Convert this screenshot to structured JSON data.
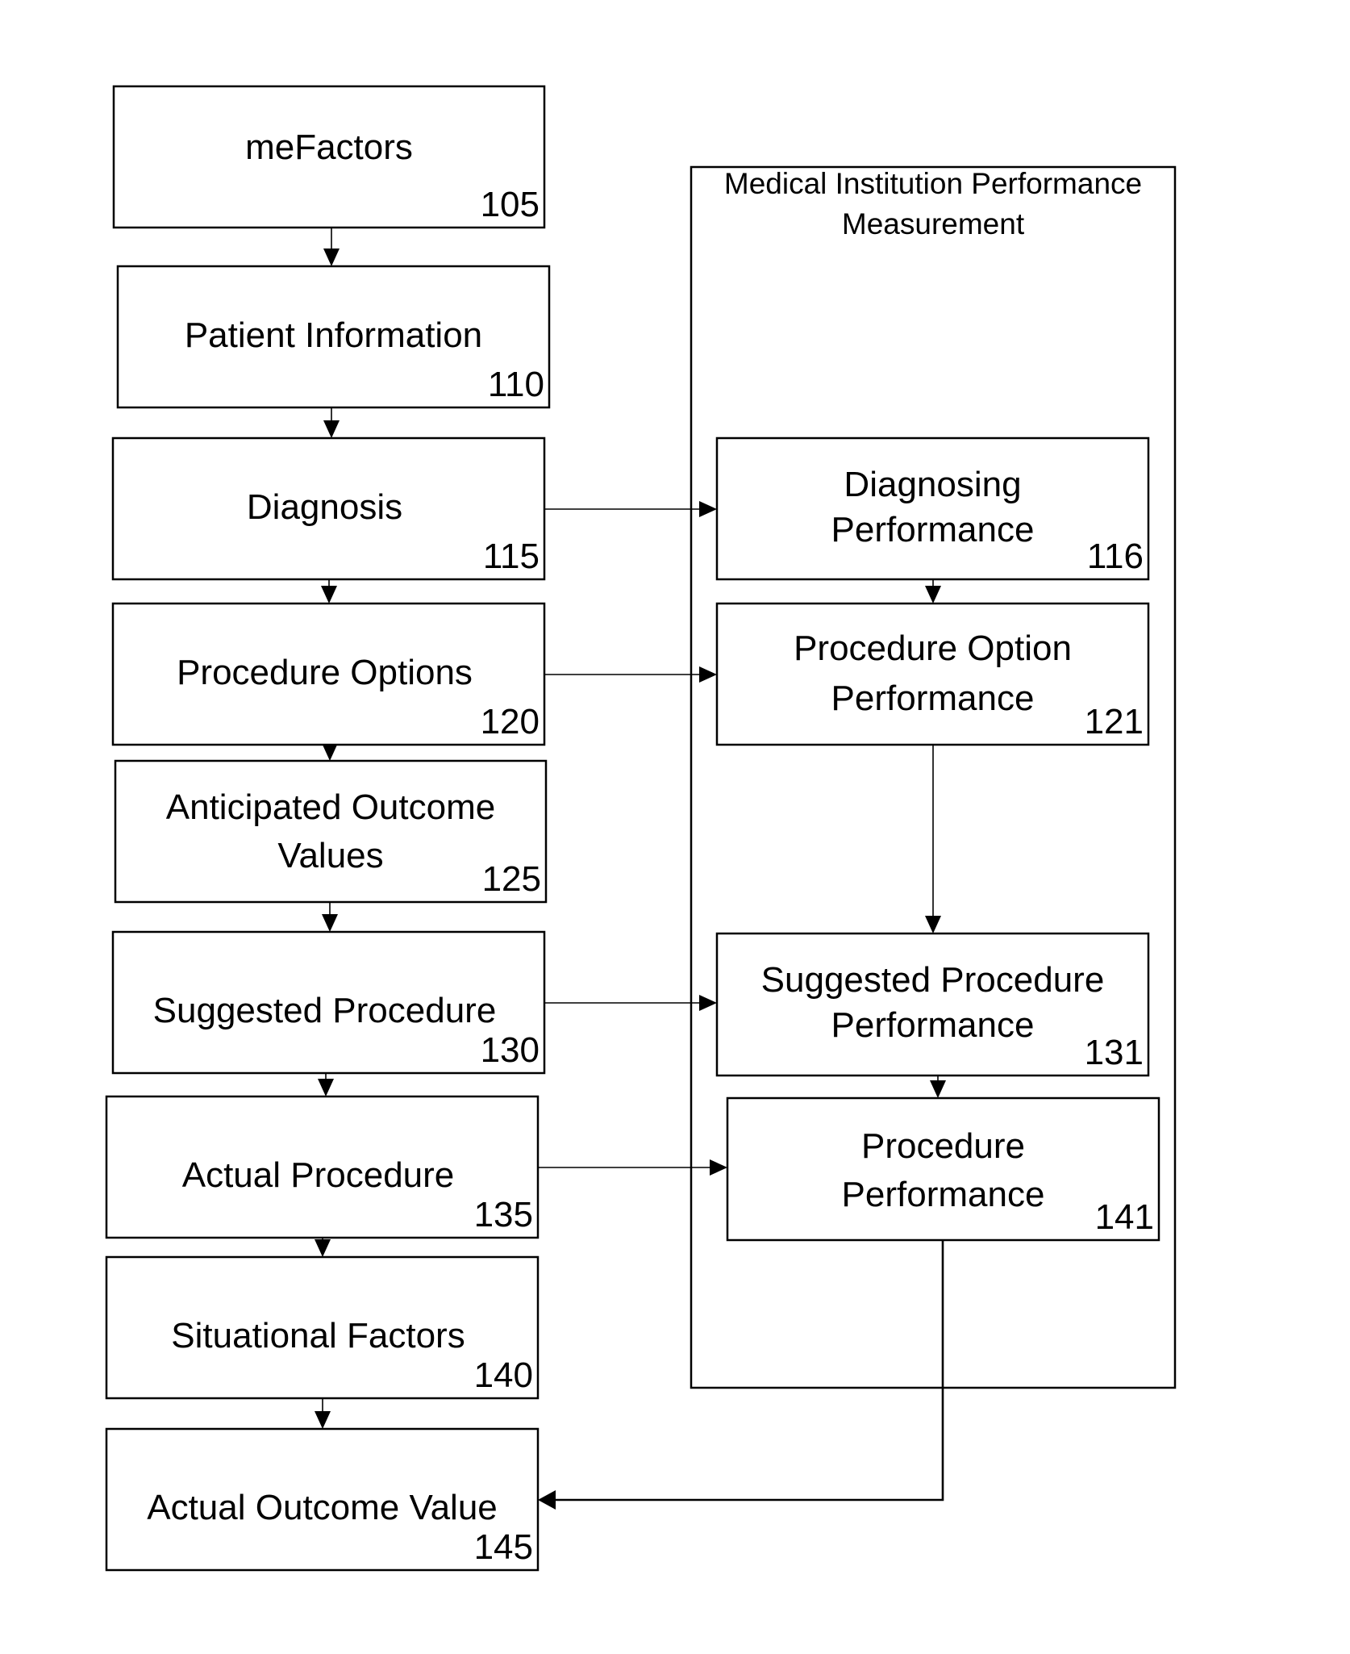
{
  "diagram": {
    "container": {
      "id": "mipm",
      "title_lines": [
        "Medical Institution Performance",
        "Measurement"
      ]
    },
    "left_column": [
      {
        "id": "105",
        "lines": [
          "meFactors"
        ],
        "ref": "105"
      },
      {
        "id": "110",
        "lines": [
          "Patient Information"
        ],
        "ref": "110"
      },
      {
        "id": "115",
        "lines": [
          "Diagnosis"
        ],
        "ref": "115"
      },
      {
        "id": "120",
        "lines": [
          "Procedure Options"
        ],
        "ref": "120"
      },
      {
        "id": "125",
        "lines": [
          "Anticipated Outcome",
          "Values"
        ],
        "ref": "125"
      },
      {
        "id": "130",
        "lines": [
          "Suggested Procedure"
        ],
        "ref": "130"
      },
      {
        "id": "135",
        "lines": [
          "Actual Procedure"
        ],
        "ref": "135"
      },
      {
        "id": "140",
        "lines": [
          "Situational Factors"
        ],
        "ref": "140"
      },
      {
        "id": "145",
        "lines": [
          "Actual Outcome Value"
        ],
        "ref": "145"
      }
    ],
    "right_column": [
      {
        "id": "116",
        "lines": [
          "Diagnosing",
          "Performance"
        ],
        "ref": "116"
      },
      {
        "id": "121",
        "lines": [
          "Procedure Option",
          "Performance"
        ],
        "ref": "121"
      },
      {
        "id": "131",
        "lines": [
          "Suggested Procedure",
          "Performance"
        ],
        "ref": "131"
      },
      {
        "id": "141",
        "lines": [
          "Procedure",
          "Performance"
        ],
        "ref": "141"
      }
    ],
    "edges": [
      {
        "from": "105",
        "to": "110"
      },
      {
        "from": "110",
        "to": "115"
      },
      {
        "from": "115",
        "to": "120"
      },
      {
        "from": "120",
        "to": "125"
      },
      {
        "from": "125",
        "to": "130"
      },
      {
        "from": "130",
        "to": "135"
      },
      {
        "from": "135",
        "to": "140"
      },
      {
        "from": "140",
        "to": "145"
      },
      {
        "from": "115",
        "to": "116"
      },
      {
        "from": "120",
        "to": "121"
      },
      {
        "from": "130",
        "to": "131"
      },
      {
        "from": "135",
        "to": "141"
      },
      {
        "from": "116",
        "to": "121"
      },
      {
        "from": "121",
        "to": "131"
      },
      {
        "from": "131",
        "to": "141"
      },
      {
        "from": "141",
        "to": "145"
      }
    ]
  }
}
